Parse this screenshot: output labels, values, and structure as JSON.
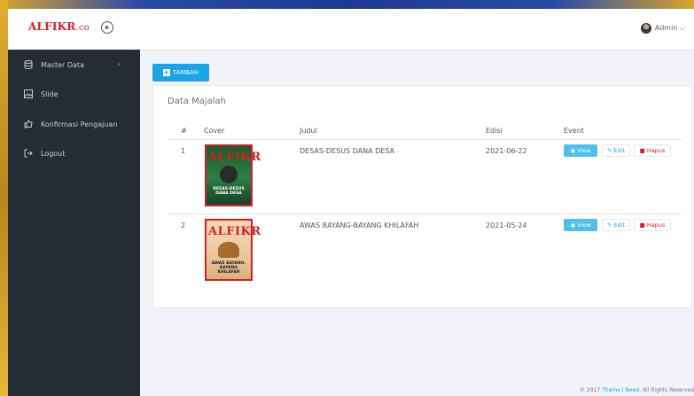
{
  "app": {
    "brand_main": "ALFIKR",
    "brand_suffix": ".co"
  },
  "topbar": {
    "user_label": "Admin ⌵"
  },
  "sidebar": {
    "items": [
      {
        "label": "Master Data",
        "icon": "database-icon",
        "chevron": "‹"
      },
      {
        "label": "Slide",
        "icon": "image-icon"
      },
      {
        "label": "Konfirmasi Pengajuan",
        "icon": "thumbs-up-icon"
      },
      {
        "label": "Logout",
        "icon": "logout-icon"
      }
    ]
  },
  "toolbar": {
    "add_label": "TAMBAH"
  },
  "panel": {
    "title": "Data Majalah",
    "columns": [
      "#",
      "Cover",
      "Judul",
      "Edisi",
      "Event"
    ],
    "rows": [
      {
        "num": "1",
        "judul": "DESAS-DESUS DANA DESA",
        "edisi": "2021-06-22",
        "cover_mast": "ALFIKR",
        "cover_caption": "DESAS-DESUS DANA DESA"
      },
      {
        "num": "2",
        "judul": "AWAS BAYANG-BAYANG KHILAFAH",
        "edisi": "2021-05-24",
        "cover_mast": "ALFIKR",
        "cover_caption": "AWAS BAYANG-BAYANG KHILAFAH"
      }
    ],
    "actions": {
      "view": "View",
      "edit": "Edit",
      "delete": "Hapus"
    }
  },
  "footer": {
    "prefix": "© 2017",
    "link": "Theme I Need",
    "suffix": ". All Rights Reserved"
  },
  "colors": {
    "accent": "#1aa4e8",
    "danger": "#d81e24",
    "sidebar": "#262c36",
    "view": "#4fc1e9"
  }
}
